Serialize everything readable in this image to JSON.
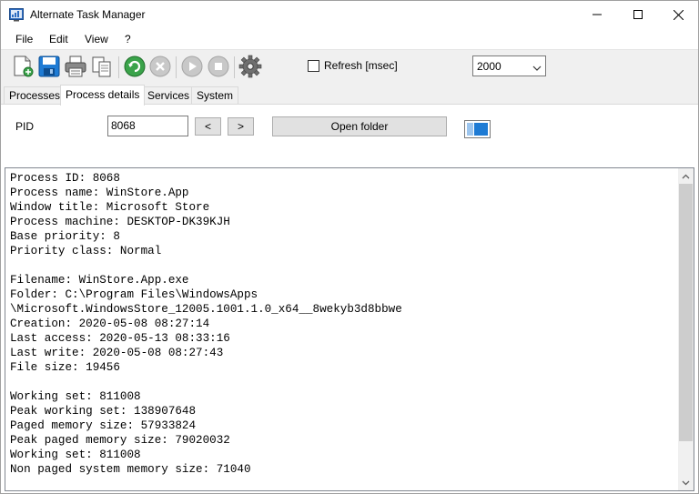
{
  "window": {
    "title": "Alternate Task Manager"
  },
  "menu": {
    "items": [
      "File",
      "Edit",
      "View",
      "?"
    ]
  },
  "toolbar": {
    "icons": [
      "new-icon",
      "save-icon",
      "print-icon",
      "copy-icon",
      "refresh-icon",
      "kill-icon",
      "play-icon",
      "stop-icon",
      "gear-icon"
    ],
    "refresh_label": "Refresh [msec]",
    "refresh_checked": false,
    "interval_value": "2000"
  },
  "tabs": [
    "Processes",
    "Process details",
    "Services",
    "System"
  ],
  "active_tab": "Process details",
  "process_details": {
    "pid_label": "PID",
    "pid_value": "8068",
    "prev_label": "<",
    "next_label": ">",
    "open_folder_label": "Open folder",
    "lines": [
      "Process ID: 8068",
      "Process name: WinStore.App",
      "Window title: Microsoft Store",
      "Process machine: DESKTOP-DK39KJH",
      "Base priority: 8",
      "Priority class: Normal",
      "",
      "Filename: WinStore.App.exe",
      "Folder: C:\\Program Files\\WindowsApps",
      "\\Microsoft.WindowsStore_12005.1001.1.0_x64__8wekyb3d8bbwe",
      "Creation: 2020-05-08 08:27:14",
      "Last access: 2020-05-13 08:33:16",
      "Last write: 2020-05-08 08:27:43",
      "File size: 19456",
      "",
      "Working set: 811008",
      "Peak working set: 138907648",
      "Paged memory size: 57933824",
      "Peak paged memory size: 79020032",
      "Working set: 811008",
      "Non paged system memory size: 71040"
    ]
  },
  "colors": {
    "accent": "#1e7bd4",
    "refresh_green": "#3aa34a"
  }
}
